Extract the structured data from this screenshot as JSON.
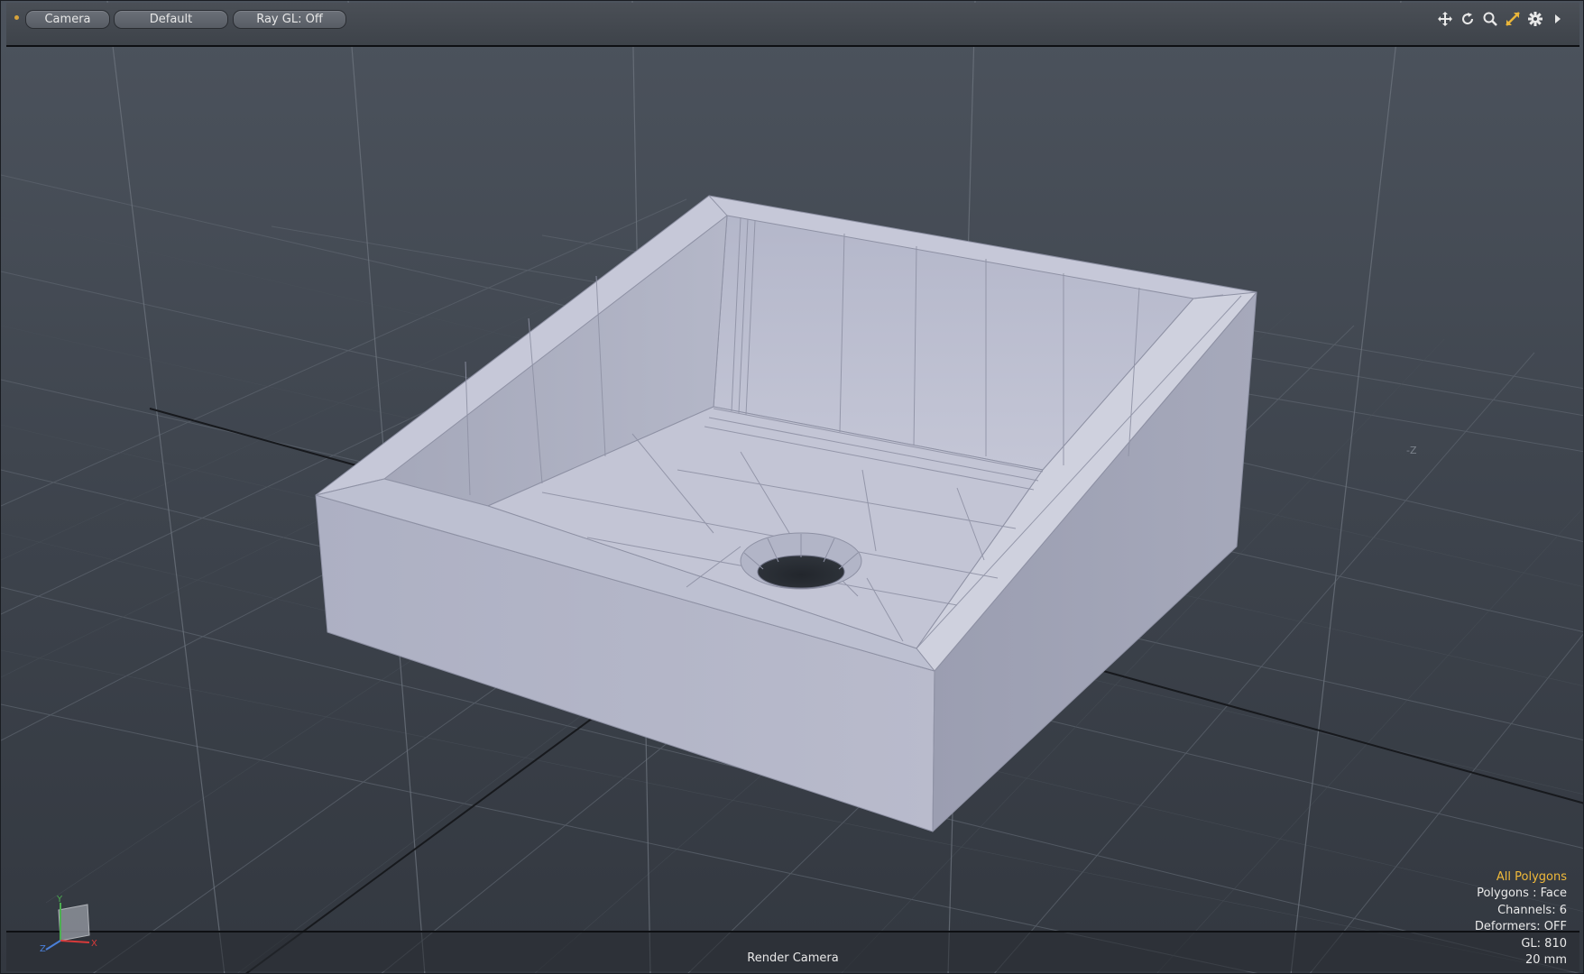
{
  "toolbar": {
    "camera_label": "Camera",
    "shading_label": "Default",
    "raygl_label": "Ray GL: Off",
    "icons": [
      "move-icon",
      "rotate-icon",
      "zoom-icon",
      "maximize-icon",
      "gear-icon",
      "expand-arrow-icon"
    ]
  },
  "viewport": {
    "label": "Render Camera",
    "axis_hint": "-Z",
    "axis_labels": {
      "x": "X",
      "y": "Y",
      "z": "Z"
    }
  },
  "info": {
    "selection_mode": "All Polygons",
    "polygons": "Polygons : Face",
    "channels": "Channels: 6",
    "deformers": "Deformers: OFF",
    "gl": "GL: 810",
    "scale": "20 mm"
  },
  "colors": {
    "background": "#3a4049",
    "mesh": "#b6b9cc",
    "highlight": "#f0b93a"
  }
}
